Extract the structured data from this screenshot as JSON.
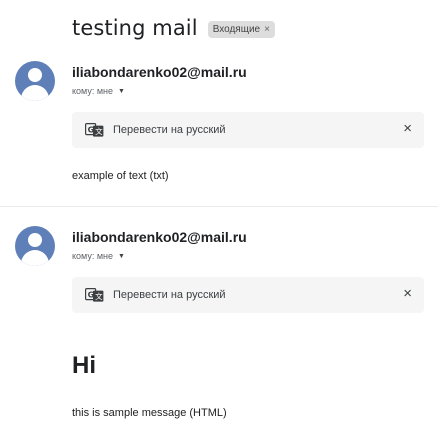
{
  "thread": {
    "subject": "testing mail",
    "label": "Входящие",
    "label_remove": "×"
  },
  "messages": [
    {
      "sender": "iliabondarenko02@mail.ru",
      "recipient": "кому: мне",
      "translate_link": "Перевести на русский",
      "translate_close": "×",
      "body": "example of text (txt)"
    },
    {
      "sender": "iliabondarenko02@mail.ru",
      "recipient": "кому: мне",
      "translate_link": "Перевести на русский",
      "translate_close": "×",
      "body_heading": "Hi",
      "body": "this is sample message (HTML)"
    }
  ],
  "colors": {
    "avatar": "#5f7fb8",
    "translate_bar": "#f5f5f5",
    "label_chip": "#dddddd"
  },
  "icons": {
    "avatar": "person-icon",
    "translate": "translate-icon",
    "caret": "chevron-down-icon",
    "close": "close-icon"
  }
}
